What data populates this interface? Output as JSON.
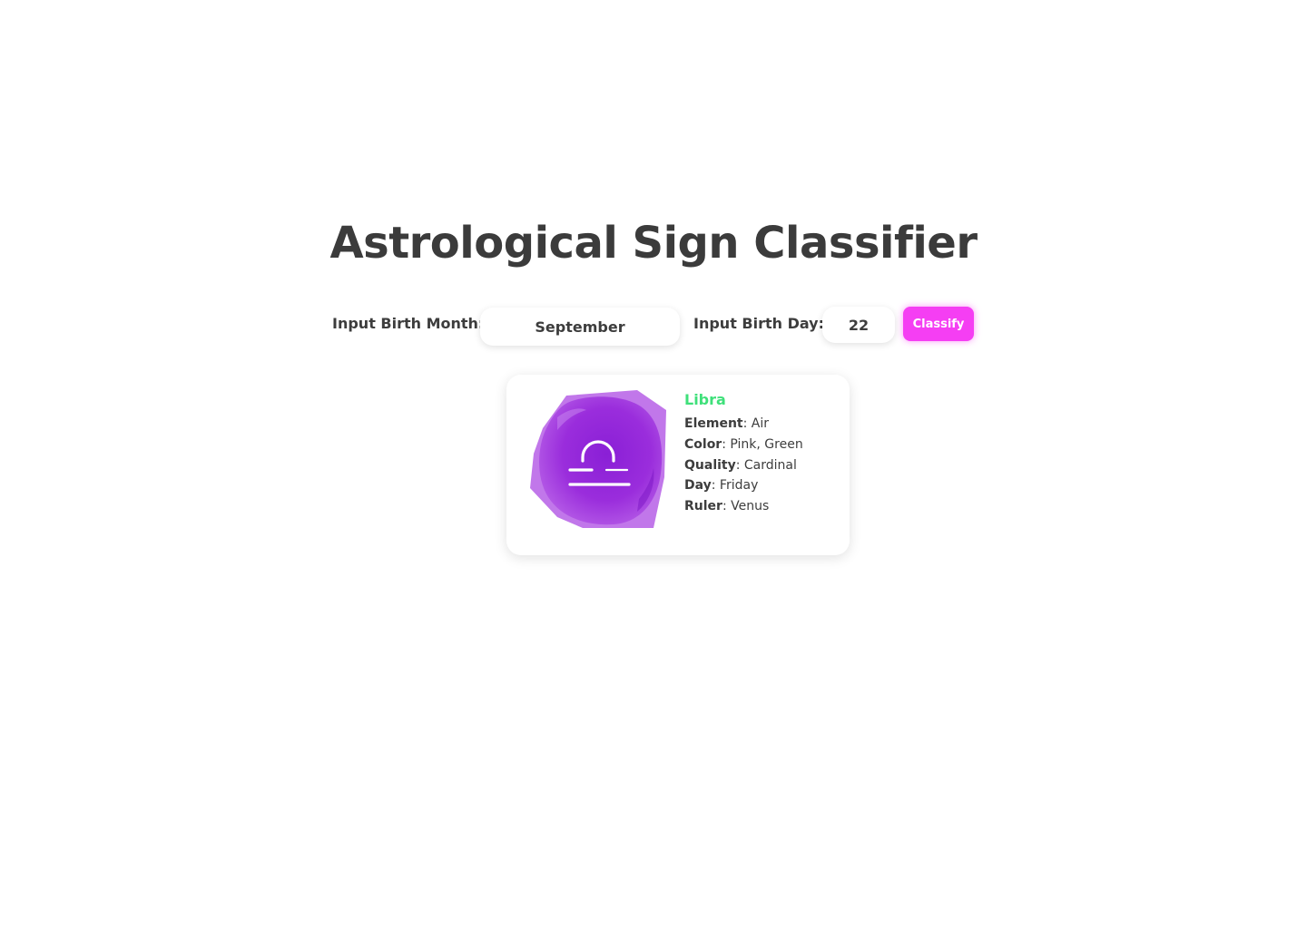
{
  "header": {
    "title": "Astrological Sign Classifier"
  },
  "form": {
    "month_label": "Input Birth Month:",
    "month_value": "September",
    "day_label": "Input Birth Day:",
    "day_value": "22",
    "classify_label": "Classify",
    "classify_color": "#f53ef3"
  },
  "result": {
    "sign_name": "Libra",
    "sign_name_color": "#3fe07a",
    "image_icon": "libra-symbol-icon",
    "image_color": "#9b2ddb",
    "attributes": [
      {
        "key": "Element",
        "value": ": Air"
      },
      {
        "key": "Color",
        "value": ": Pink, Green"
      },
      {
        "key": "Quality",
        "value": ": Cardinal"
      },
      {
        "key": "Day",
        "value": ": Friday"
      },
      {
        "key": "Ruler",
        "value": ": Venus"
      }
    ]
  }
}
